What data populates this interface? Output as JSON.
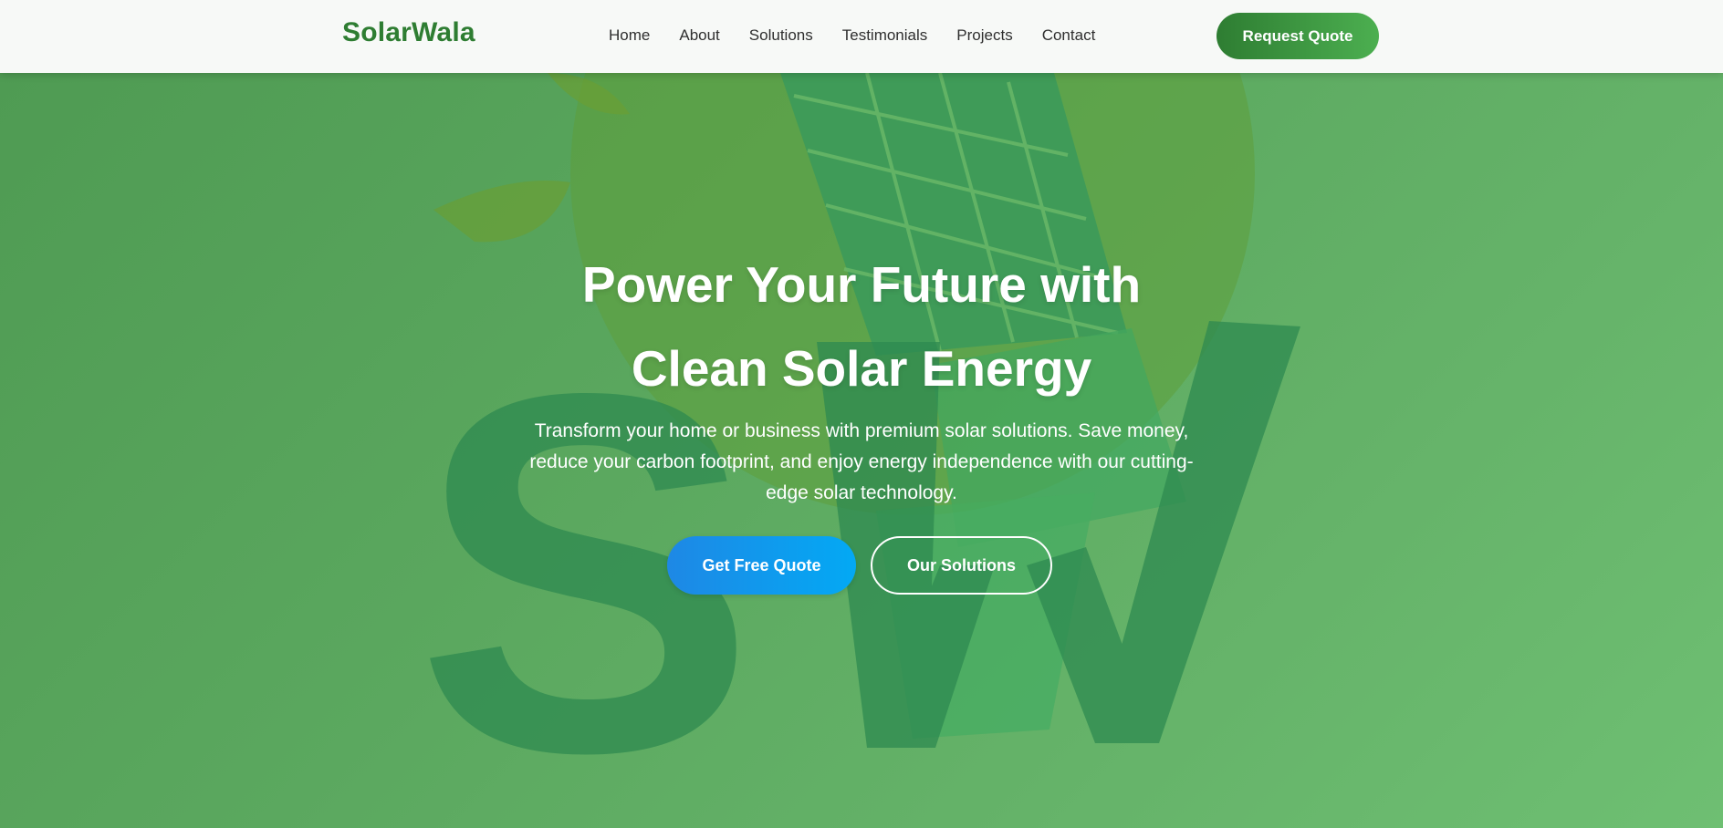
{
  "header": {
    "brand": "SolarWala",
    "nav": [
      {
        "label": "Home"
      },
      {
        "label": "About"
      },
      {
        "label": "Solutions"
      },
      {
        "label": "Testimonials"
      },
      {
        "label": "Projects"
      },
      {
        "label": "Contact"
      }
    ],
    "cta_label": "Request Quote"
  },
  "hero": {
    "title_line1": "Power Your Future with",
    "title_line2": "Clean Solar Energy",
    "subtitle": "Transform your home or business with premium solar solutions. Save money, reduce your carbon footprint, and enjoy energy independence with our cutting-edge solar technology.",
    "primary_cta": "Get Free Quote",
    "secondary_cta": "Our Solutions"
  },
  "background": {
    "logo_letters": "SW"
  },
  "colors": {
    "brand": "#2e7d32",
    "hero_bg": "#5aa75e",
    "primary_cta": "#1e88e5",
    "request_quote": "#388e3c"
  }
}
